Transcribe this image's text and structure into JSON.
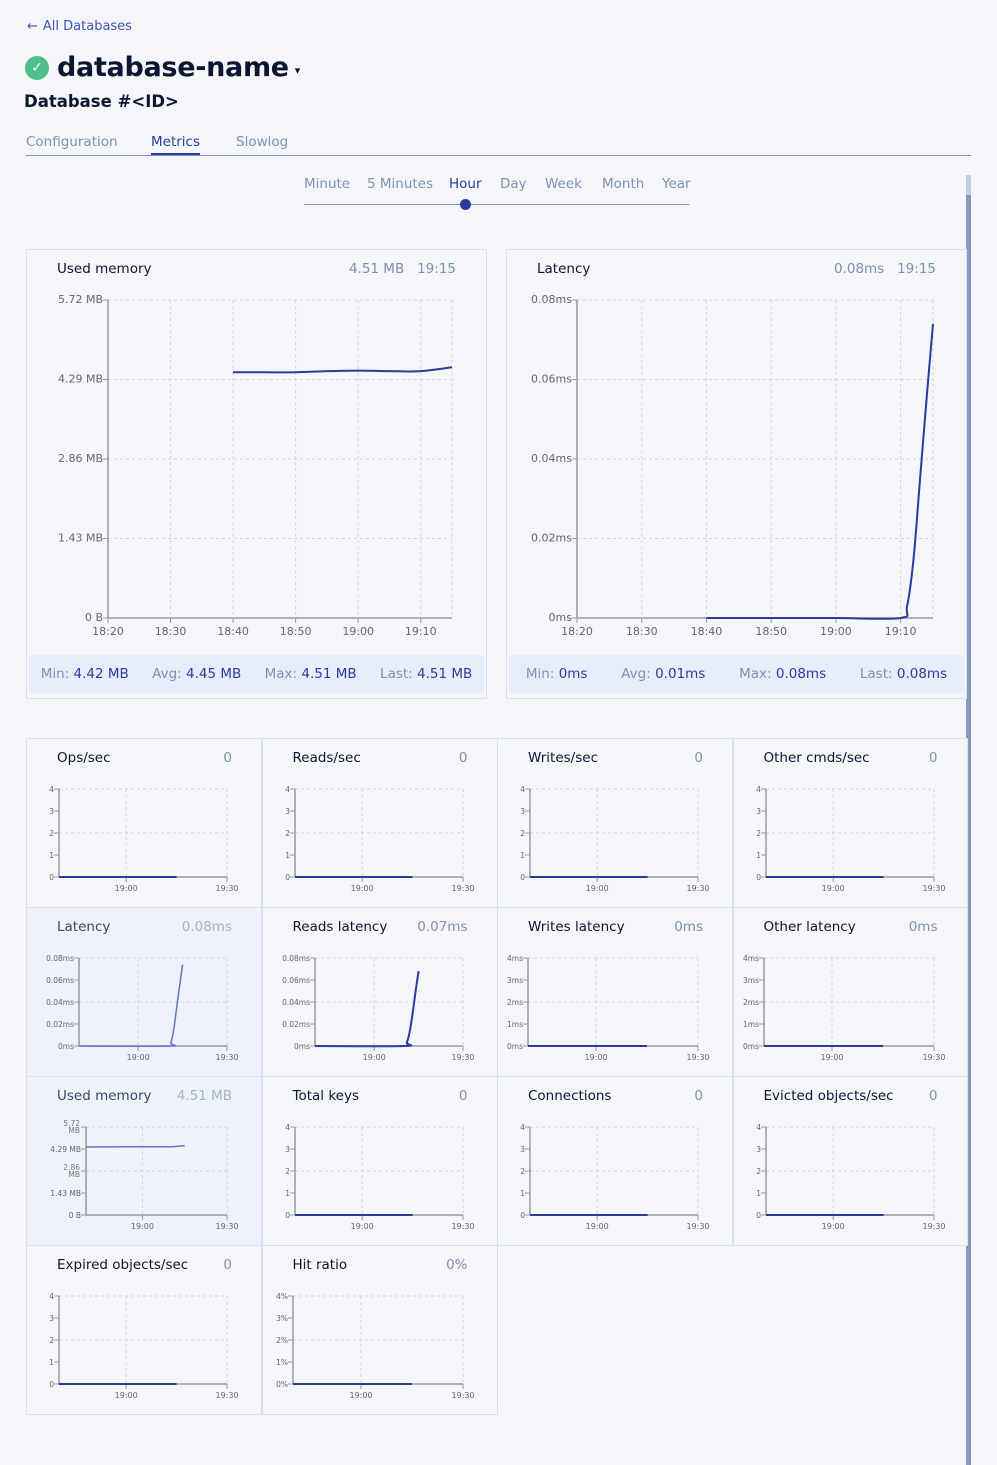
{
  "nav": {
    "back_label": "All Databases",
    "back_icon": "arrow-left-icon"
  },
  "header": {
    "status_icon": "check-circle-icon",
    "status_color": "#4fbf8a",
    "db_name": "database-name",
    "db_id": "Database #<ID>"
  },
  "tabs": [
    {
      "label": "Configuration",
      "active": false
    },
    {
      "label": "Metrics",
      "active": true
    },
    {
      "label": "Slowlog",
      "active": false
    }
  ],
  "time_range": {
    "options": [
      "Minute",
      "5 Minutes",
      "Hour",
      "Day",
      "Week",
      "Month",
      "Year"
    ],
    "selected": "Hour"
  },
  "colors": {
    "accent": "#2b3b9a",
    "line": "#2b3b9a",
    "line_light": "#6574c4",
    "stats_bg": "#e6eefc"
  },
  "big_charts": [
    {
      "title": "Used memory",
      "current_value": "4.51 MB",
      "current_time": "19:15",
      "stats": [
        {
          "label": "Min:",
          "value": "4.42 MB"
        },
        {
          "label": "Avg:",
          "value": "4.45 MB"
        },
        {
          "label": "Max:",
          "value": "4.51 MB"
        },
        {
          "label": "Last:",
          "value": "4.51 MB"
        }
      ]
    },
    {
      "title": "Latency",
      "current_value": "0.08ms",
      "current_time": "19:15",
      "stats": [
        {
          "label": "Min:",
          "value": "0ms"
        },
        {
          "label": "Avg:",
          "value": "0.01ms"
        },
        {
          "label": "Max:",
          "value": "0.08ms"
        },
        {
          "label": "Last:",
          "value": "0.08ms"
        }
      ]
    }
  ],
  "small_charts": [
    {
      "title": "Ops/sec",
      "value": "0",
      "highlight": false
    },
    {
      "title": "Reads/sec",
      "value": "0",
      "highlight": false
    },
    {
      "title": "Writes/sec",
      "value": "0",
      "highlight": false
    },
    {
      "title": "Other cmds/sec",
      "value": "0",
      "highlight": false
    },
    {
      "title": "Latency",
      "value": "0.08ms",
      "highlight": true
    },
    {
      "title": "Reads latency",
      "value": "0.07ms",
      "highlight": false
    },
    {
      "title": "Writes latency",
      "value": "0ms",
      "highlight": false
    },
    {
      "title": "Other latency",
      "value": "0ms",
      "highlight": false
    },
    {
      "title": "Used memory",
      "value": "4.51 MB",
      "highlight": true
    },
    {
      "title": "Total keys",
      "value": "0",
      "highlight": false
    },
    {
      "title": "Connections",
      "value": "0",
      "highlight": false
    },
    {
      "title": "Evicted objects/sec",
      "value": "0",
      "highlight": false
    },
    {
      "title": "Expired objects/sec",
      "value": "0",
      "highlight": false
    },
    {
      "title": "Hit ratio",
      "value": "0%",
      "highlight": false
    }
  ],
  "chart_data": [
    {
      "type": "line",
      "title": "Used memory",
      "xlabel": "",
      "ylabel": "",
      "x_ticks": [
        "18:20",
        "18:30",
        "18:40",
        "18:50",
        "19:00",
        "19:10"
      ],
      "y_ticks": [
        "0 B",
        "1.43 MB",
        "2.86 MB",
        "4.29 MB",
        "5.72 MB"
      ],
      "xlim_minutes": [
        0,
        55
      ],
      "ylim": [
        0,
        5.72
      ],
      "grid": true,
      "series": [
        {
          "name": "Used memory (MB)",
          "x_minutes": [
            20,
            25,
            30,
            35,
            40,
            45,
            50,
            55
          ],
          "values": [
            4.42,
            4.42,
            4.42,
            4.44,
            4.45,
            4.44,
            4.44,
            4.51
          ]
        }
      ]
    },
    {
      "type": "line",
      "title": "Latency",
      "xlabel": "",
      "ylabel": "",
      "x_ticks": [
        "18:20",
        "18:30",
        "18:40",
        "18:50",
        "19:00",
        "19:10"
      ],
      "y_ticks": [
        "0ms",
        "0.02ms",
        "0.04ms",
        "0.06ms",
        "0.08ms"
      ],
      "xlim_minutes": [
        0,
        55
      ],
      "ylim": [
        0,
        0.08
      ],
      "grid": true,
      "series": [
        {
          "name": "Latency (ms)",
          "x_minutes": [
            20,
            30,
            40,
            50,
            51,
            52,
            53,
            54,
            55
          ],
          "values": [
            0,
            0,
            0,
            0,
            0.003,
            0.015,
            0.035,
            0.055,
            0.074
          ]
        }
      ]
    },
    {
      "type": "line",
      "title": "Ops/sec",
      "x_ticks": [
        "19:00",
        "19:30"
      ],
      "y_ticks": [
        "0",
        "1",
        "2",
        "3",
        "4"
      ],
      "ylim": [
        0,
        4
      ],
      "grid": true,
      "series": [
        {
          "name": "Ops/sec",
          "x_minutes": [
            -20,
            15
          ],
          "values": [
            0,
            0
          ]
        }
      ]
    },
    {
      "type": "line",
      "title": "Reads/sec",
      "x_ticks": [
        "19:00",
        "19:30"
      ],
      "y_ticks": [
        "0",
        "1",
        "2",
        "3",
        "4"
      ],
      "ylim": [
        0,
        4
      ],
      "grid": true,
      "series": [
        {
          "name": "Reads/sec",
          "x_minutes": [
            -20,
            15
          ],
          "values": [
            0,
            0
          ]
        }
      ]
    },
    {
      "type": "line",
      "title": "Writes/sec",
      "x_ticks": [
        "19:00",
        "19:30"
      ],
      "y_ticks": [
        "0",
        "1",
        "2",
        "3",
        "4"
      ],
      "ylim": [
        0,
        4
      ],
      "grid": true,
      "series": [
        {
          "name": "Writes/sec",
          "x_minutes": [
            -20,
            15
          ],
          "values": [
            0,
            0
          ]
        }
      ]
    },
    {
      "type": "line",
      "title": "Other cmds/sec",
      "x_ticks": [
        "19:00",
        "19:30"
      ],
      "y_ticks": [
        "0",
        "1",
        "2",
        "3",
        "4"
      ],
      "ylim": [
        0,
        4
      ],
      "grid": true,
      "series": [
        {
          "name": "Other cmds/sec",
          "x_minutes": [
            -20,
            15
          ],
          "values": [
            0,
            0
          ]
        }
      ]
    },
    {
      "type": "line",
      "title": "Latency",
      "x_ticks": [
        "19:00",
        "19:30"
      ],
      "y_ticks": [
        "0ms",
        "0.02ms",
        "0.04ms",
        "0.06ms",
        "0.08ms"
      ],
      "ylim": [
        0,
        0.08
      ],
      "grid": true,
      "series": [
        {
          "name": "Latency",
          "x_minutes": [
            -20,
            10,
            11,
            12,
            13,
            14,
            15
          ],
          "values": [
            0,
            0,
            0.003,
            0.015,
            0.035,
            0.055,
            0.074
          ]
        }
      ]
    },
    {
      "type": "line",
      "title": "Reads latency",
      "x_ticks": [
        "19:00",
        "19:30"
      ],
      "y_ticks": [
        "0ms",
        "0.02ms",
        "0.04ms",
        "0.06ms",
        "0.08ms"
      ],
      "ylim": [
        0,
        0.08
      ],
      "grid": true,
      "series": [
        {
          "name": "Reads latency",
          "x_minutes": [
            -20,
            10,
            11,
            12,
            13,
            14,
            15
          ],
          "values": [
            0,
            0,
            0.003,
            0.013,
            0.03,
            0.05,
            0.068
          ]
        }
      ]
    },
    {
      "type": "line",
      "title": "Writes latency",
      "x_ticks": [
        "19:00",
        "19:30"
      ],
      "y_ticks": [
        "0ms",
        "1ms",
        "2ms",
        "3ms",
        "4ms"
      ],
      "ylim": [
        0,
        4
      ],
      "grid": true,
      "series": [
        {
          "name": "Writes latency",
          "x_minutes": [
            -20,
            15
          ],
          "values": [
            0,
            0
          ]
        }
      ]
    },
    {
      "type": "line",
      "title": "Other latency",
      "x_ticks": [
        "19:00",
        "19:30"
      ],
      "y_ticks": [
        "0ms",
        "1ms",
        "2ms",
        "3ms",
        "4ms"
      ],
      "ylim": [
        0,
        4
      ],
      "grid": true,
      "series": [
        {
          "name": "Other latency",
          "x_minutes": [
            -20,
            15
          ],
          "values": [
            0,
            0
          ]
        }
      ]
    },
    {
      "type": "line",
      "title": "Used memory",
      "x_ticks": [
        "19:00",
        "19:30"
      ],
      "y_ticks": [
        "0 B",
        "1.43 MB",
        "2.86 MB",
        "4.29 MB",
        "5.72 MB"
      ],
      "ylim": [
        0,
        5.72
      ],
      "grid": true,
      "series": [
        {
          "name": "Used memory",
          "x_minutes": [
            -20,
            -5,
            5,
            10,
            15
          ],
          "values": [
            4.42,
            4.44,
            4.44,
            4.44,
            4.51
          ]
        }
      ]
    },
    {
      "type": "line",
      "title": "Total keys",
      "x_ticks": [
        "19:00",
        "19:30"
      ],
      "y_ticks": [
        "0",
        "1",
        "2",
        "3",
        "4"
      ],
      "ylim": [
        0,
        4
      ],
      "grid": true,
      "series": [
        {
          "name": "Total keys",
          "x_minutes": [
            -20,
            15
          ],
          "values": [
            0,
            0
          ]
        }
      ]
    },
    {
      "type": "line",
      "title": "Connections",
      "x_ticks": [
        "19:00",
        "19:30"
      ],
      "y_ticks": [
        "0",
        "1",
        "2",
        "3",
        "4"
      ],
      "ylim": [
        0,
        4
      ],
      "grid": true,
      "series": [
        {
          "name": "Connections",
          "x_minutes": [
            -20,
            15
          ],
          "values": [
            0,
            0
          ]
        }
      ]
    },
    {
      "type": "line",
      "title": "Evicted objects/sec",
      "x_ticks": [
        "19:00",
        "19:30"
      ],
      "y_ticks": [
        "0",
        "1",
        "2",
        "3",
        "4"
      ],
      "ylim": [
        0,
        4
      ],
      "grid": true,
      "series": [
        {
          "name": "Evicted objects/sec",
          "x_minutes": [
            -20,
            15
          ],
          "values": [
            0,
            0
          ]
        }
      ]
    },
    {
      "type": "line",
      "title": "Expired objects/sec",
      "x_ticks": [
        "19:00",
        "19:30"
      ],
      "y_ticks": [
        "0",
        "1",
        "2",
        "3",
        "4"
      ],
      "ylim": [
        0,
        4
      ],
      "grid": true,
      "series": [
        {
          "name": "Expired objects/sec",
          "x_minutes": [
            -20,
            15
          ],
          "values": [
            0,
            0
          ]
        }
      ]
    },
    {
      "type": "line",
      "title": "Hit ratio",
      "x_ticks": [
        "19:00",
        "19:30"
      ],
      "y_ticks": [
        "0%",
        "1%",
        "2%",
        "3%",
        "4%"
      ],
      "ylim": [
        0,
        4
      ],
      "grid": true,
      "series": [
        {
          "name": "Hit ratio",
          "x_minutes": [
            -20,
            15
          ],
          "values": [
            0,
            0
          ]
        }
      ]
    }
  ]
}
